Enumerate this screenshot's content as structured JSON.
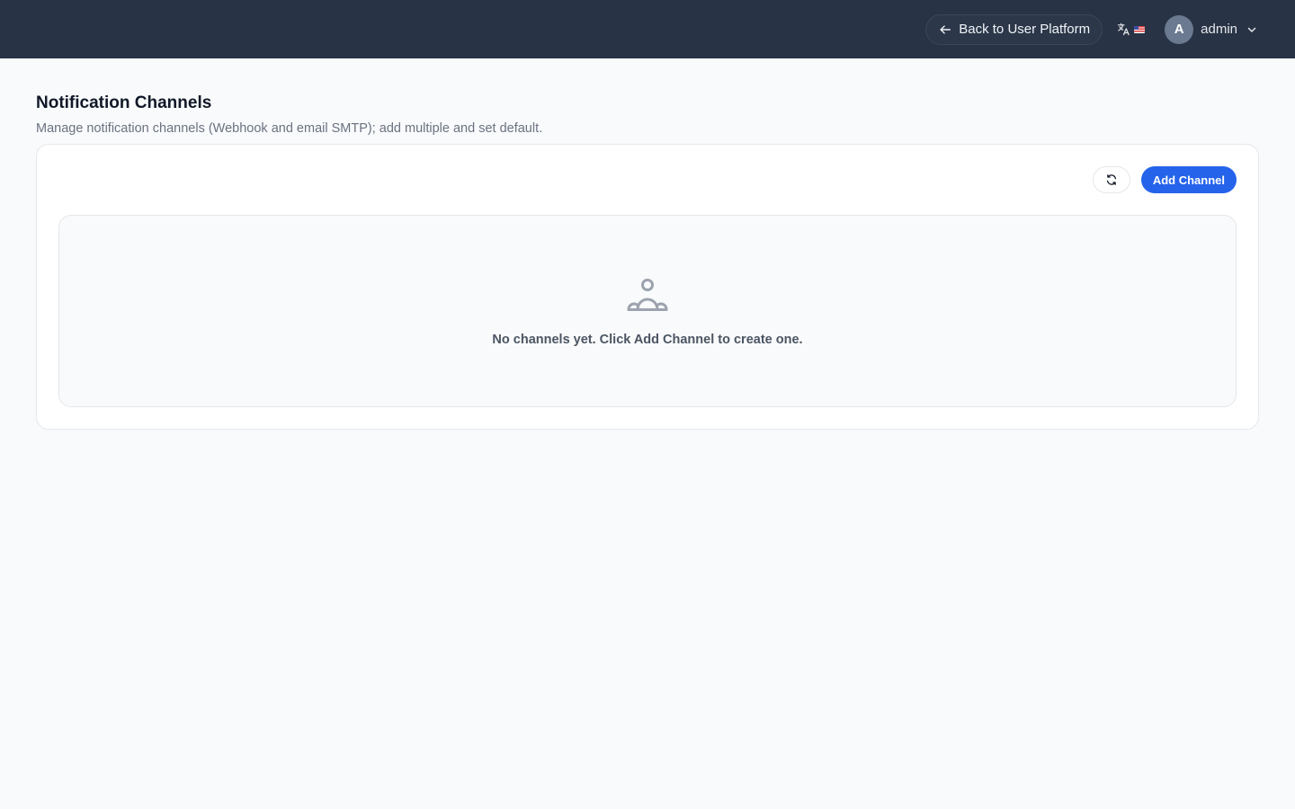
{
  "header": {
    "back_label": "Back to User Platform",
    "back_icon": "arrow-left-icon",
    "language_icon": "translate-icon",
    "flag_icon": "us-flag-icon",
    "user": {
      "avatar_initial": "A",
      "name": "admin",
      "menu_icon": "chevron-down-icon"
    }
  },
  "page": {
    "title": "Notification Channels",
    "subtitle": "Manage notification channels (Webhook and email SMTP); add multiple and set default."
  },
  "toolbar": {
    "refresh_icon": "refresh-icon",
    "add_label": "Add Channel"
  },
  "empty_state": {
    "icon": "users-group-icon",
    "message": "No channels yet. Click Add Channel to create one."
  },
  "colors": {
    "topbar": "#283345",
    "primary": "#2563eb",
    "background": "#f8fafc"
  }
}
